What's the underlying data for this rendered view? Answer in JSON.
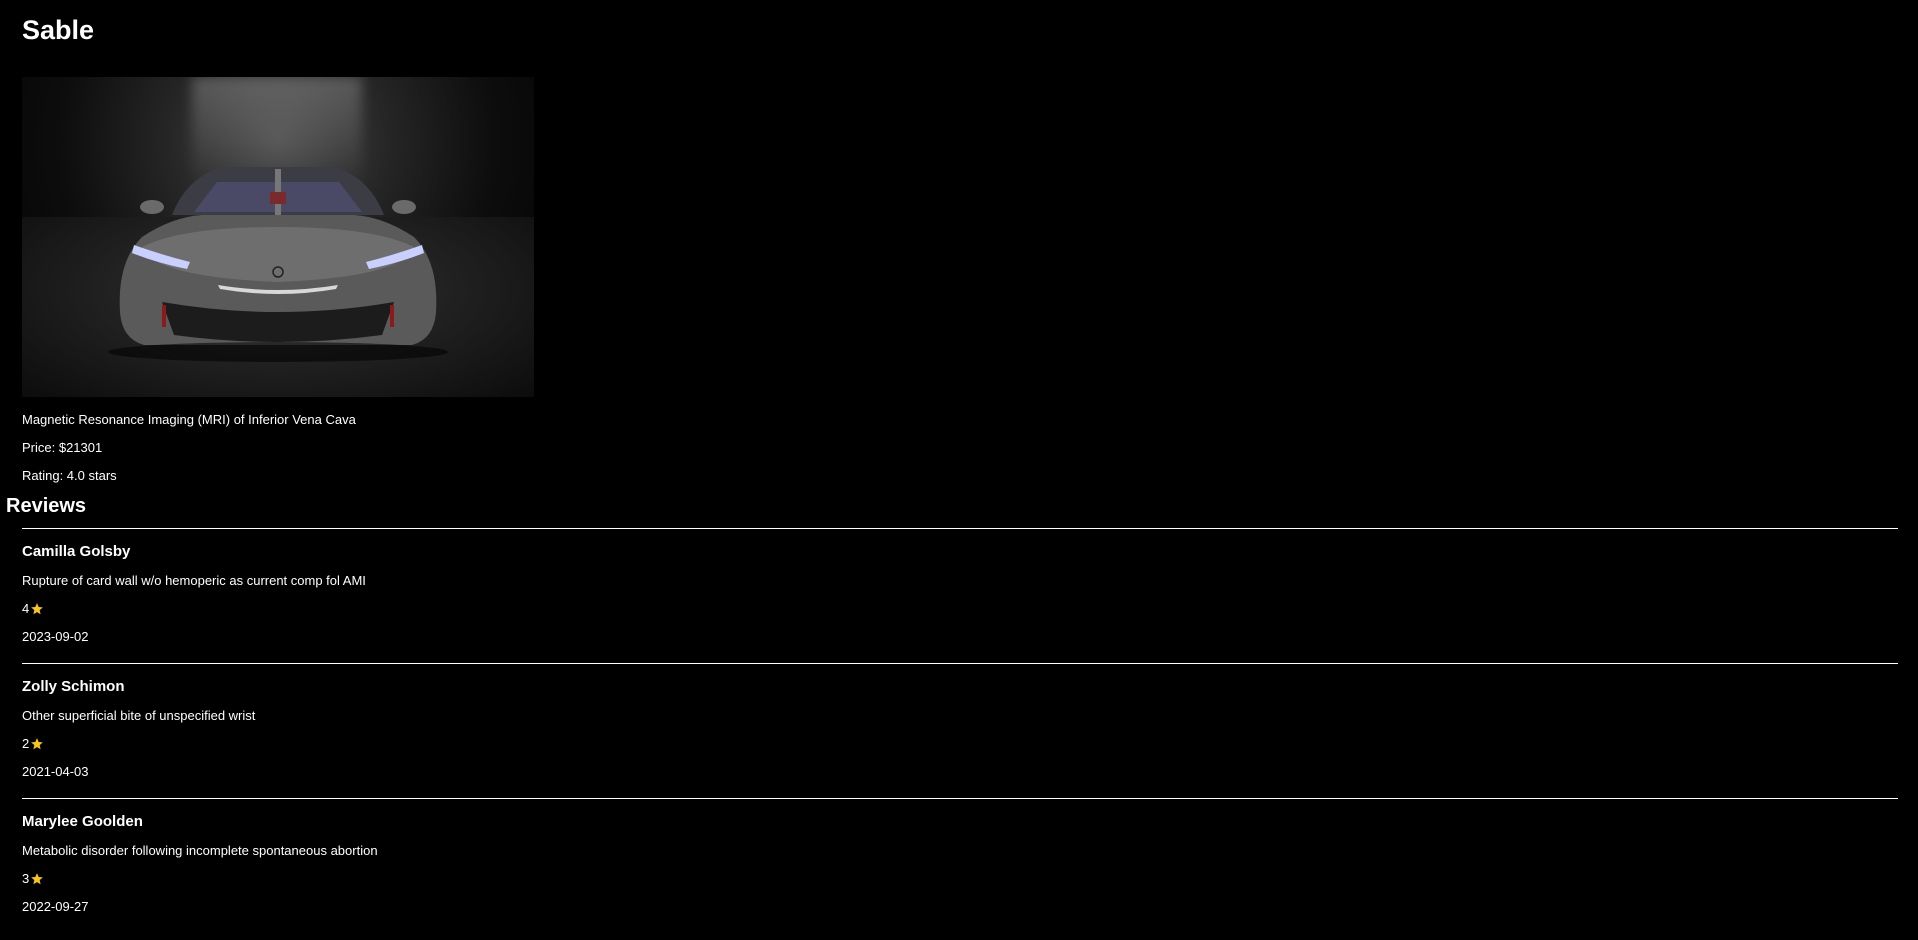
{
  "product": {
    "title": "Sable",
    "image_icon": "car-photo",
    "description": "Magnetic Resonance Imaging (MRI) of Inferior Vena Cava",
    "price_text": "Price: $21301",
    "rating_text": "Rating: 4.0 stars"
  },
  "reviews": {
    "heading": "Reviews",
    "star_color": "#f5c518",
    "divider_color": "#ffffff",
    "items": [
      {
        "name": "Camilla Golsby",
        "text": "Rupture of card wall w/o hemoperic as current comp fol AMI",
        "stars": "4",
        "date": "2023-09-02"
      },
      {
        "name": "Zolly Schimon",
        "text": "Other superficial bite of unspecified wrist",
        "stars": "2",
        "date": "2021-04-03"
      },
      {
        "name": "Marylee Goolden",
        "text": "Metabolic disorder following incomplete spontaneous abortion",
        "stars": "3",
        "date": "2022-09-27"
      }
    ]
  }
}
